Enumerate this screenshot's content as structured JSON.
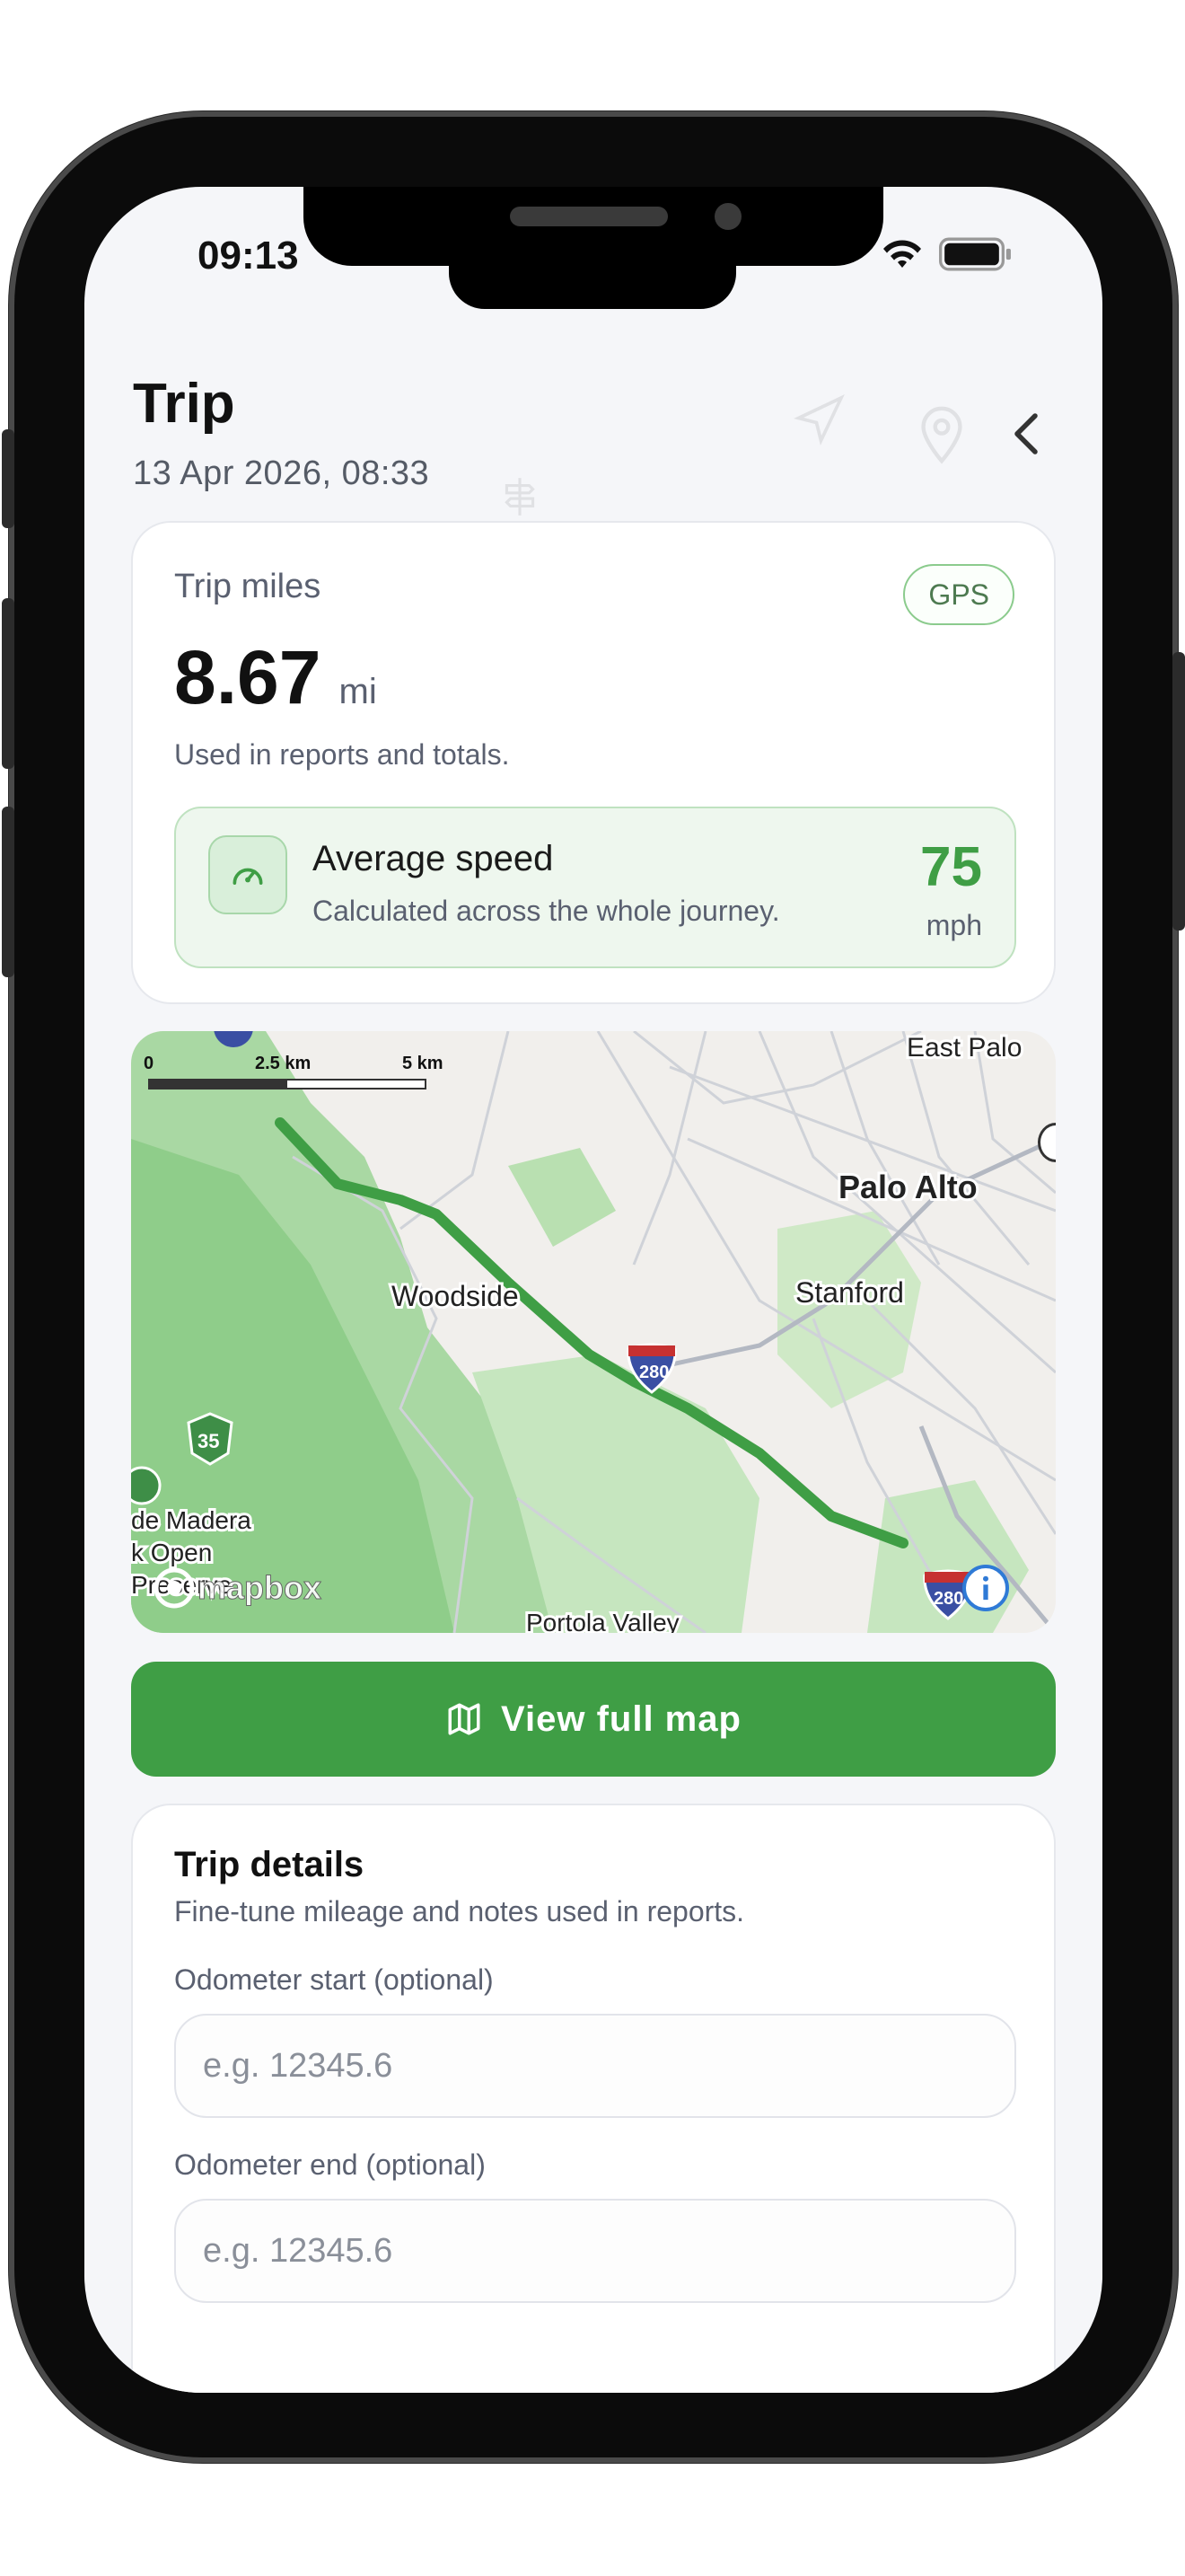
{
  "status_bar": {
    "time": "09:13"
  },
  "header": {
    "title": "Trip",
    "subtitle": "13 Apr 2026, 08:33"
  },
  "miles_card": {
    "label": "Trip miles",
    "badge": "GPS",
    "value": "8.67",
    "unit": "mi",
    "note": "Used in reports and totals."
  },
  "speed": {
    "title": "Average speed",
    "subtitle": "Calculated across the whole journey.",
    "value": "75",
    "unit": "mph"
  },
  "map": {
    "scale": [
      "0",
      "2.5 km",
      "5 km"
    ],
    "labels": {
      "east_palo": "East Palo",
      "palo_alto": "Palo Alto",
      "woodside": "Woodside",
      "stanford": "Stanford",
      "madera1": "de Madera",
      "madera2": "k Open",
      "madera3": "Preserve",
      "portola": "Portola Valley",
      "shield_280a": "280",
      "shield_280b": "280",
      "shield_35": "35"
    },
    "logo": "mapbox",
    "colors": {
      "route": "#3f9e45",
      "park": "#b7dfb0",
      "forest": "#8fcd8a",
      "road": "#c9ccd3"
    }
  },
  "full_map_button": {
    "label": "View full map"
  },
  "details": {
    "title": "Trip details",
    "subtitle": "Fine-tune mileage and notes used in reports.",
    "odo_start_label": "Odometer start (optional)",
    "odo_start_placeholder": "e.g. 12345.6",
    "odo_end_label": "Odometer end (optional)",
    "odo_end_placeholder": "e.g. 12345.6"
  },
  "colors": {
    "accent": "#3f9e45",
    "background": "#f5f6f9"
  }
}
